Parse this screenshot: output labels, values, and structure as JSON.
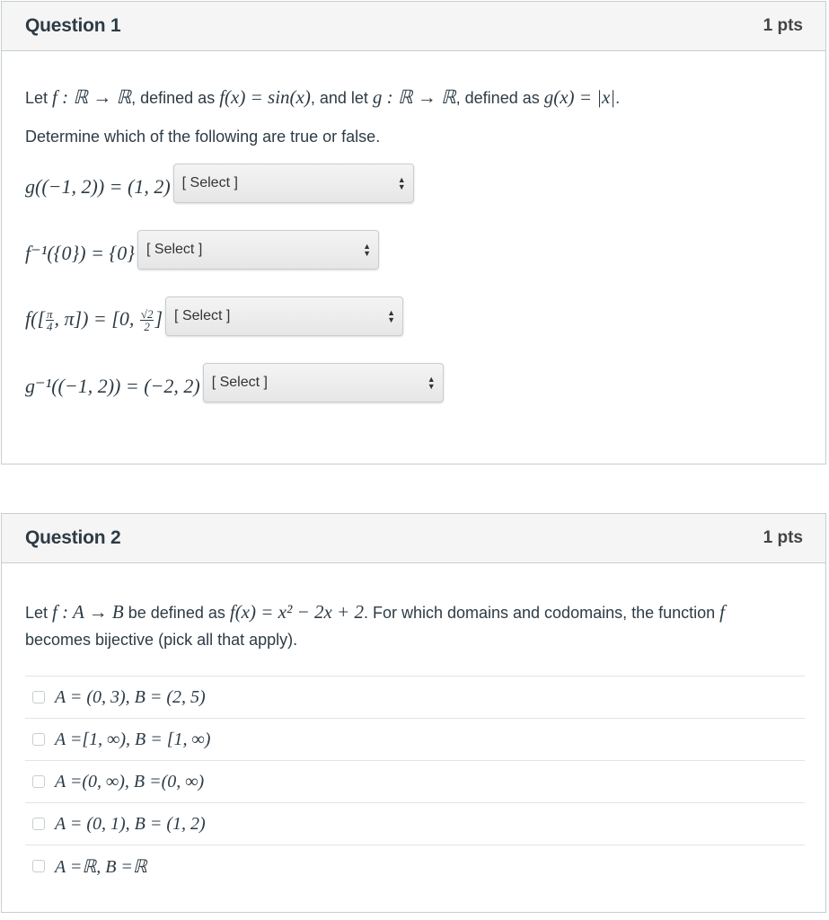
{
  "questions": [
    {
      "title": "Question 1",
      "points": "1 pts",
      "intro": {
        "prefix": "Let ",
        "f_decl": "f : ℝ → ℝ",
        "mid1": ", defined as ",
        "f_def": "f(x) = sin(x)",
        "mid2": ", and let ",
        "g_decl": "g : ℝ → ℝ",
        "mid3": ", defined as ",
        "g_def": "g(x) = |x|",
        "suffix": "."
      },
      "instruction": "Determine which of the following are true or false.",
      "items": [
        {
          "expr": "g((−1, 2)) = (1, 2)",
          "select": "[ Select ]"
        },
        {
          "expr": "f⁻¹({0}) = {0}",
          "select": "[ Select ]"
        },
        {
          "expr_pre": "f([",
          "expr_frac1_num": "π",
          "expr_frac1_den": "4",
          "expr_mid": ", π]) = [0, ",
          "expr_frac2_num": "√2",
          "expr_frac2_den": "2",
          "expr_post": "]",
          "select": "[ Select ]"
        },
        {
          "expr": "g⁻¹((−1, 2)) = (−2, 2)",
          "select": "[ Select ]"
        }
      ]
    },
    {
      "title": "Question 2",
      "points": "1 pts",
      "intro": {
        "prefix": "Let ",
        "f_decl": "f : A → B",
        "mid1": " be defined as ",
        "f_def": "f(x) = x² − 2x + 2",
        "mid2": ". For which domains and codomains, the function ",
        "f_sym": "f",
        "suffix": " becomes bijective (pick all that apply)."
      },
      "options": [
        {
          "label": "A = (0, 3), B = (2, 5)",
          "checked": false
        },
        {
          "label": "A =[1, ∞), B = [1, ∞)",
          "checked": false
        },
        {
          "label": "A =(0, ∞), B =(0, ∞)",
          "checked": false
        },
        {
          "label": "A = (0, 1),  B = (1, 2)",
          "checked": false
        },
        {
          "label": "A =ℝ, B =ℝ",
          "checked": false
        }
      ]
    }
  ],
  "icons": {
    "select_arrows": "▲▼"
  }
}
